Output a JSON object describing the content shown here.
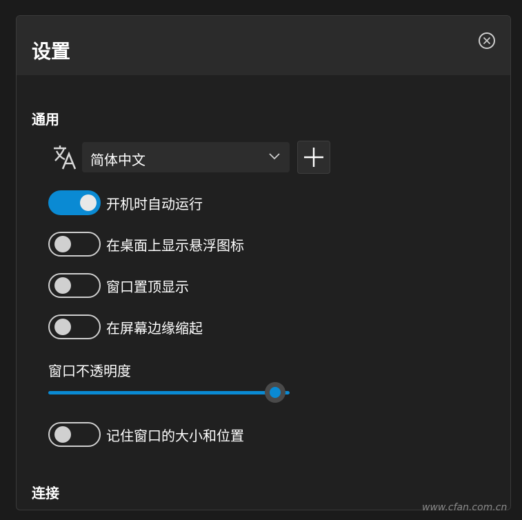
{
  "dialog": {
    "title": "设置",
    "close_icon": "close-circle-icon"
  },
  "general": {
    "section_title": "通用",
    "language": {
      "icon": "translate-icon",
      "selected": "简体中文",
      "add_icon": "plus-icon"
    },
    "toggles": [
      {
        "label": "开机时自动运行",
        "on": true
      },
      {
        "label": "在桌面上显示悬浮图标",
        "on": false
      },
      {
        "label": "窗口置顶显示",
        "on": false
      },
      {
        "label": "在屏幕边缘缩起",
        "on": false
      }
    ],
    "opacity": {
      "label": "窗口不透明度",
      "value_fraction": 0.94
    },
    "remember_toggle": {
      "label": "记住窗口的大小和位置",
      "on": false
    }
  },
  "connection": {
    "section_title": "连接"
  },
  "watermark": "www.cfan.com.cn",
  "colors": {
    "accent": "#0a8ad3",
    "background": "#202020",
    "header": "#2b2b2b"
  }
}
